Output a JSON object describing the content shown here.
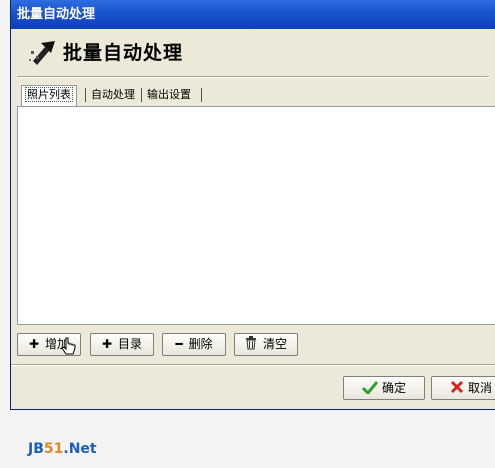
{
  "window": {
    "title": "批量自动处理"
  },
  "header": {
    "title": "批量自动处理",
    "icon": "wand-icon"
  },
  "tabs": [
    {
      "label": "照片列表",
      "active": true
    },
    {
      "label": "自动处理",
      "active": false
    },
    {
      "label": "输出设置",
      "active": false
    }
  ],
  "toolbar": {
    "add_label": "增加",
    "folder_label": "目录",
    "delete_label": "删除",
    "clear_label": "清空"
  },
  "footer": {
    "ok_label": "确定",
    "cancel_label": "取消"
  },
  "watermark": {
    "prefix": "JB",
    "middle": "51",
    "suffix": ".Net"
  }
}
